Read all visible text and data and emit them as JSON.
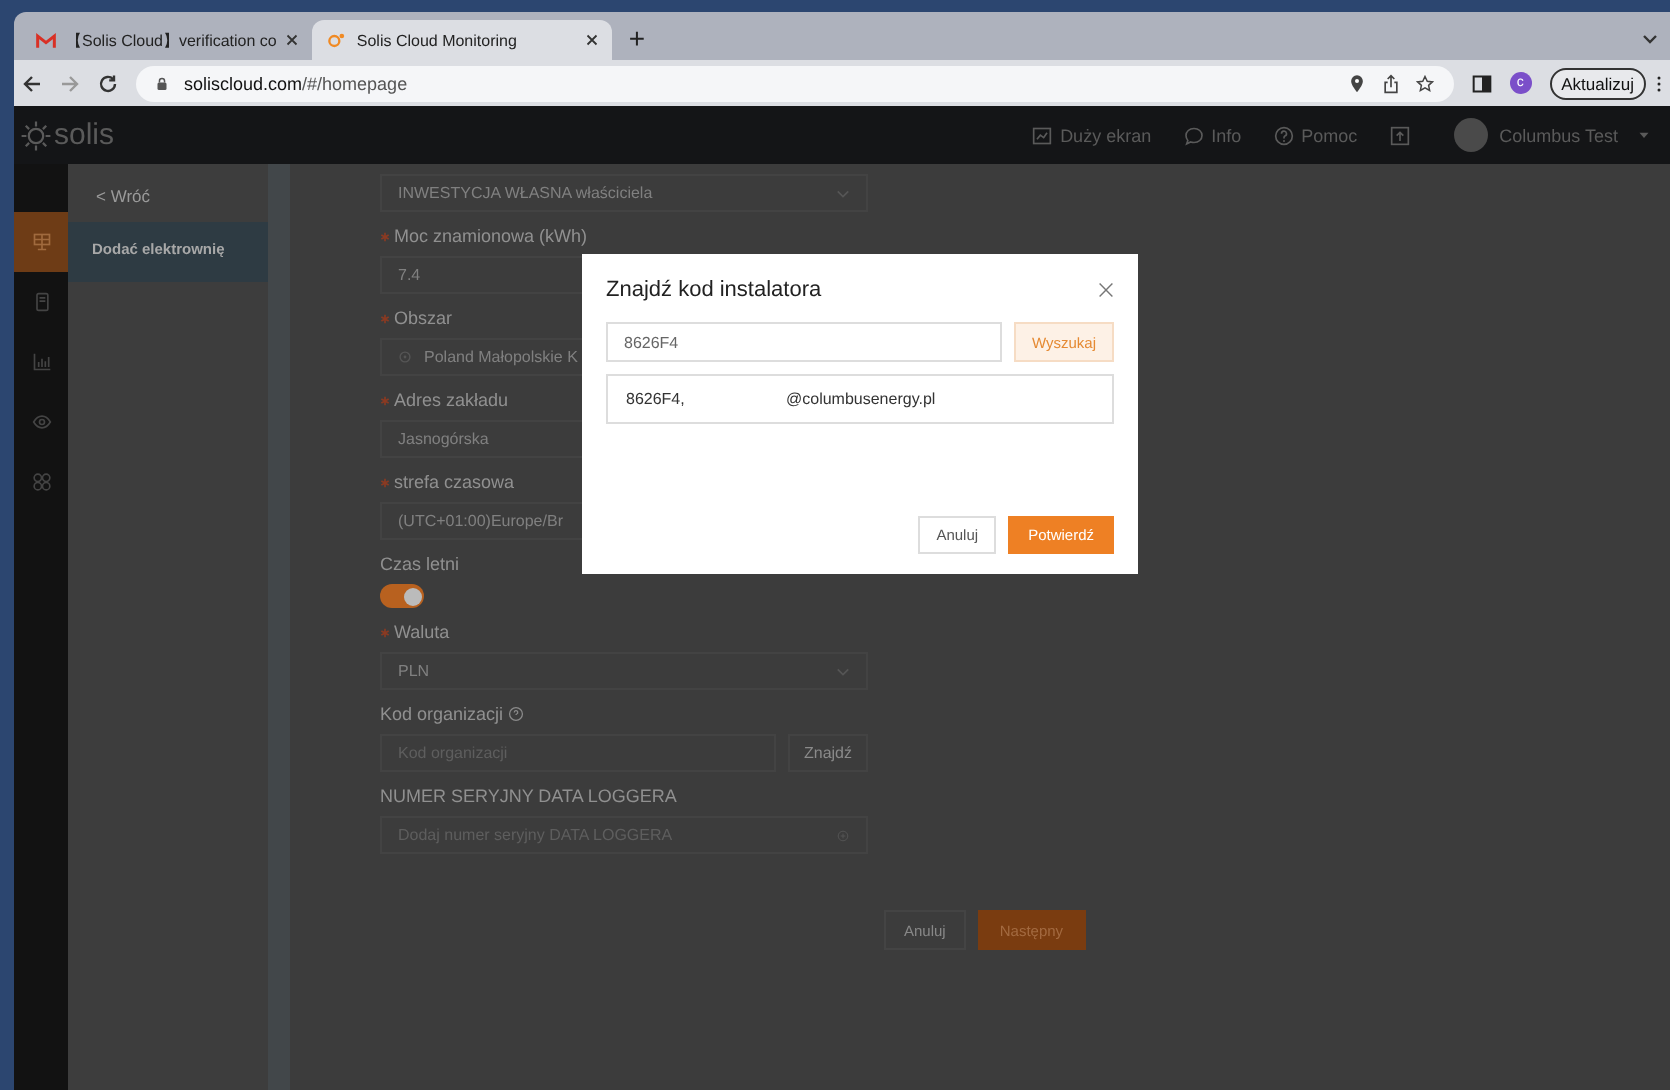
{
  "browser": {
    "tabs": [
      {
        "title": "【Solis Cloud】verification co",
        "selected": false
      },
      {
        "title": "Solis Cloud Monitoring",
        "selected": true
      }
    ],
    "new_tab": "+",
    "address": {
      "host": "soliscloud.com",
      "path": "/#/homepage"
    },
    "profile_letter": "c",
    "update_button": "Aktualizuj"
  },
  "header": {
    "logo": "solis",
    "nav": [
      {
        "label": "Duży ekran"
      },
      {
        "label": "Info"
      },
      {
        "label": "Pomoc"
      }
    ],
    "user": "Columbus Test"
  },
  "sidebar": {
    "items": [
      {
        "selected": true
      },
      {
        "selected": false
      },
      {
        "selected": false
      },
      {
        "selected": false
      },
      {
        "selected": false
      }
    ]
  },
  "submenu": {
    "back": "< Wróć",
    "items": [
      {
        "label": "Dodać elektrownię",
        "selected": true
      }
    ]
  },
  "form": {
    "fields": [
      {
        "kind": "select",
        "value": "INWESTYCJA WŁASNA właściciela"
      },
      {
        "kind": "input",
        "label": "Moc znamionowa (kWh)",
        "required": true,
        "value": "7.4"
      },
      {
        "kind": "location",
        "label": "Obszar",
        "required": true,
        "value": "Poland Małopolskie K"
      },
      {
        "kind": "input",
        "label": "Adres zakładu",
        "required": true,
        "value": "Jasnogórska"
      },
      {
        "kind": "input",
        "label": "strefa czasowa",
        "required": true,
        "value": "(UTC+01:00)Europe/Br"
      },
      {
        "kind": "switch",
        "label": "Czas letni",
        "required": false,
        "on": true
      },
      {
        "kind": "select",
        "label": "Waluta",
        "required": true,
        "value": "PLN"
      },
      {
        "kind": "search",
        "label": "Kod organizacji",
        "required": false,
        "placeholder": "Kod organizacji",
        "button": "Znajdź"
      },
      {
        "kind": "add",
        "label": "NUMER SERYJNY DATA LOGGERA",
        "required": false,
        "placeholder": "Dodaj numer seryjny DATA LOGGERA"
      }
    ],
    "buttons": [
      {
        "label": "Anuluj",
        "primary": false
      },
      {
        "label": "Następny",
        "primary": true
      }
    ]
  },
  "dialog": {
    "title": "Znajdź kod instalatora",
    "search_value": "8626F4",
    "search_button": "Wyszukaj",
    "results": [
      {
        "code": "8626F4,",
        "email": "@columbusenergy.pl"
      }
    ],
    "buttons": [
      {
        "label": "Anuluj",
        "primary": false
      },
      {
        "label": "Potwierdź",
        "primary": true
      }
    ]
  }
}
